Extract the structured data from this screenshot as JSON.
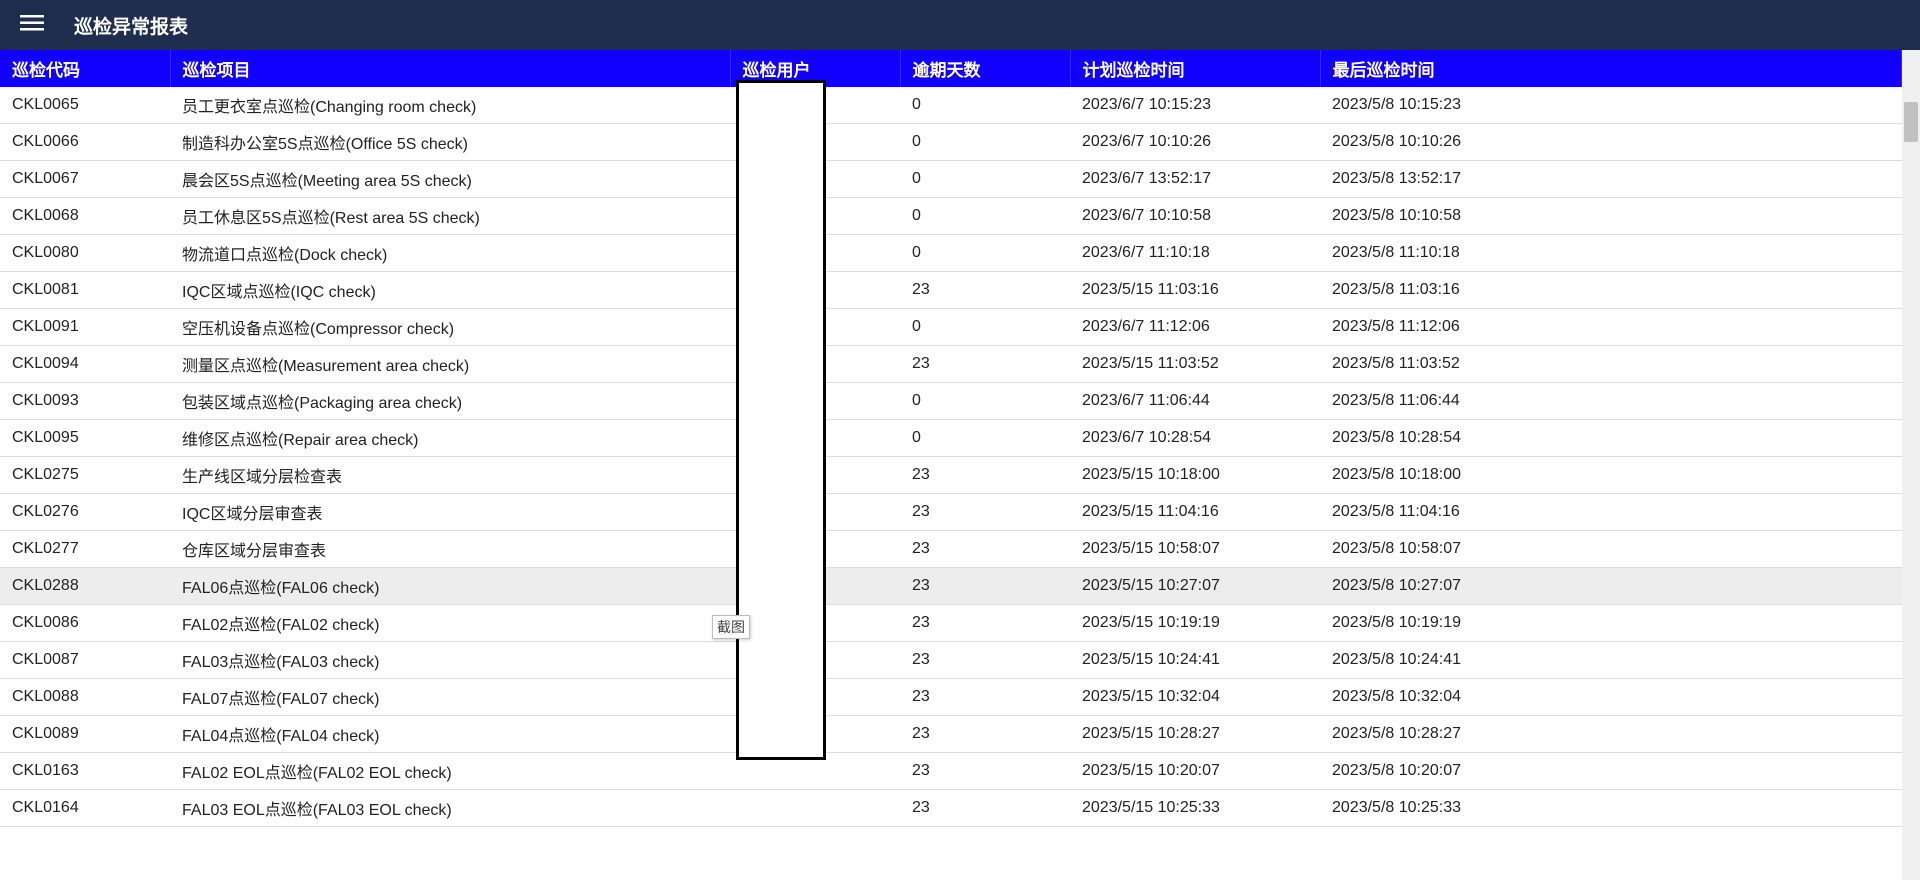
{
  "header": {
    "title": "巡检异常报表"
  },
  "floating_badge": "截图",
  "table": {
    "columns": [
      "巡检代码",
      "巡检项目",
      "巡检用户",
      "逾期天数",
      "计划巡检时间",
      "最后巡检时间"
    ],
    "rows": [
      {
        "code": "CKL0065",
        "project": "员工更衣室点巡检(Changing room check)",
        "user": "",
        "overdue": "0",
        "planned": "2023/6/7 10:15:23",
        "last": "2023/5/8 10:15:23",
        "highlight": false
      },
      {
        "code": "CKL0066",
        "project": "制造科办公室5S点巡检(Office 5S check)",
        "user": "",
        "overdue": "0",
        "planned": "2023/6/7 10:10:26",
        "last": "2023/5/8 10:10:26",
        "highlight": false
      },
      {
        "code": "CKL0067",
        "project": "晨会区5S点巡检(Meeting area 5S check)",
        "user": "",
        "overdue": "0",
        "planned": "2023/6/7 13:52:17",
        "last": "2023/5/8 13:52:17",
        "highlight": false
      },
      {
        "code": "CKL0068",
        "project": "员工休息区5S点巡检(Rest area 5S check)",
        "user": "",
        "overdue": "0",
        "planned": "2023/6/7 10:10:58",
        "last": "2023/5/8 10:10:58",
        "highlight": false
      },
      {
        "code": "CKL0080",
        "project": "物流道口点巡检(Dock check)",
        "user": "",
        "overdue": "0",
        "planned": "2023/6/7 11:10:18",
        "last": "2023/5/8 11:10:18",
        "highlight": false
      },
      {
        "code": "CKL0081",
        "project": "IQC区域点巡检(IQC check)",
        "user": "",
        "overdue": "23",
        "planned": "2023/5/15 11:03:16",
        "last": "2023/5/8 11:03:16",
        "highlight": false
      },
      {
        "code": "CKL0091",
        "project": "空压机设备点巡检(Compressor check)",
        "user": "",
        "overdue": "0",
        "planned": "2023/6/7 11:12:06",
        "last": "2023/5/8 11:12:06",
        "highlight": false
      },
      {
        "code": "CKL0094",
        "project": "测量区点巡检(Measurement area check)",
        "user": "",
        "overdue": "23",
        "planned": "2023/5/15 11:03:52",
        "last": "2023/5/8 11:03:52",
        "highlight": false
      },
      {
        "code": "CKL0093",
        "project": "包装区域点巡检(Packaging area check)",
        "user": "",
        "overdue": "0",
        "planned": "2023/6/7 11:06:44",
        "last": "2023/5/8 11:06:44",
        "highlight": false
      },
      {
        "code": "CKL0095",
        "project": "维修区点巡检(Repair area check)",
        "user": "",
        "overdue": "0",
        "planned": "2023/6/7 10:28:54",
        "last": "2023/5/8 10:28:54",
        "highlight": false
      },
      {
        "code": "CKL0275",
        "project": "生产线区域分层检查表",
        "user": "",
        "overdue": "23",
        "planned": "2023/5/15 10:18:00",
        "last": "2023/5/8 10:18:00",
        "highlight": false
      },
      {
        "code": "CKL0276",
        "project": "IQC区域分层审查表",
        "user": "",
        "overdue": "23",
        "planned": "2023/5/15 11:04:16",
        "last": "2023/5/8 11:04:16",
        "highlight": false
      },
      {
        "code": "CKL0277",
        "project": "仓库区域分层审查表",
        "user": "",
        "overdue": "23",
        "planned": "2023/5/15 10:58:07",
        "last": "2023/5/8 10:58:07",
        "highlight": false
      },
      {
        "code": "CKL0288",
        "project": "FAL06点巡检(FAL06 check)",
        "user": "",
        "overdue": "23",
        "planned": "2023/5/15 10:27:07",
        "last": "2023/5/8 10:27:07",
        "highlight": true
      },
      {
        "code": "CKL0086",
        "project": "FAL02点巡检(FAL02 check)",
        "user": "",
        "overdue": "23",
        "planned": "2023/5/15 10:19:19",
        "last": "2023/5/8 10:19:19",
        "highlight": false
      },
      {
        "code": "CKL0087",
        "project": "FAL03点巡检(FAL03 check)",
        "user": "",
        "overdue": "23",
        "planned": "2023/5/15 10:24:41",
        "last": "2023/5/8 10:24:41",
        "highlight": false
      },
      {
        "code": "CKL0088",
        "project": "FAL07点巡检(FAL07 check)",
        "user": "",
        "overdue": "23",
        "planned": "2023/5/15 10:32:04",
        "last": "2023/5/8 10:32:04",
        "highlight": false
      },
      {
        "code": "CKL0089",
        "project": "FAL04点巡检(FAL04 check)",
        "user": "",
        "overdue": "23",
        "planned": "2023/5/15 10:28:27",
        "last": "2023/5/8 10:28:27",
        "highlight": false
      },
      {
        "code": "CKL0163",
        "project": "FAL02 EOL点巡检(FAL02 EOL check)",
        "user": "",
        "overdue": "23",
        "planned": "2023/5/15 10:20:07",
        "last": "2023/5/8 10:20:07",
        "highlight": false
      },
      {
        "code": "CKL0164",
        "project": "FAL03 EOL点巡检(FAL03 EOL check)",
        "user": "",
        "overdue": "23",
        "planned": "2023/5/15 10:25:33",
        "last": "2023/5/8 10:25:33",
        "highlight": false
      }
    ]
  }
}
